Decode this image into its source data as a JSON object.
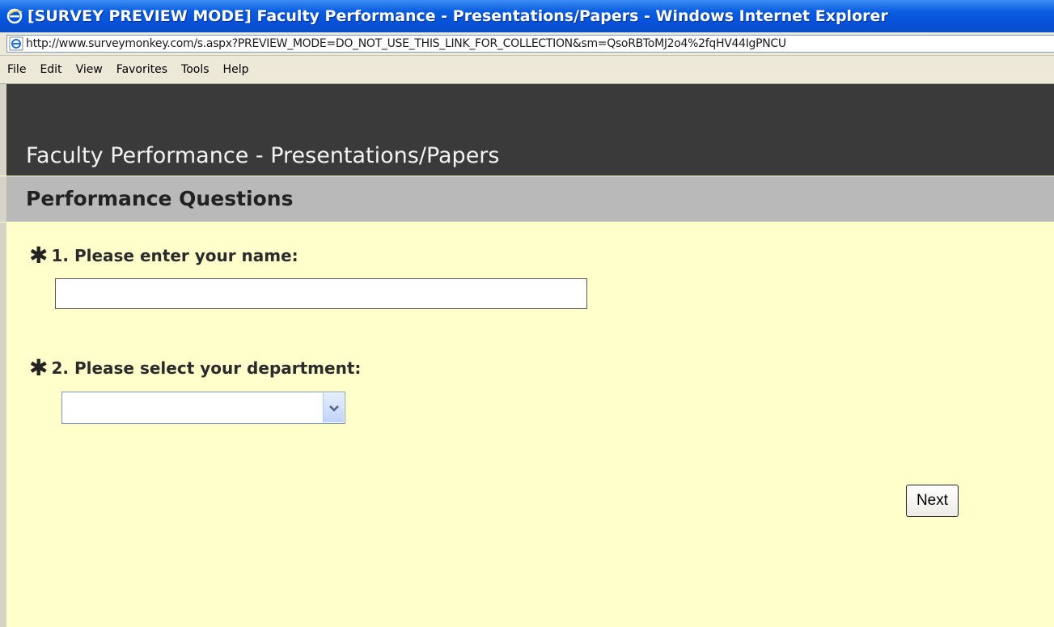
{
  "window": {
    "title": "[SURVEY PREVIEW MODE] Faculty Performance - Presentations/Papers - Windows Internet Explorer",
    "icon": "ie-icon"
  },
  "address_bar": {
    "url": "http://www.surveymonkey.com/s.aspx?PREVIEW_MODE=DO_NOT_USE_THIS_LINK_FOR_COLLECTION&sm=QsoRBToMJ2o4%2fqHV44IgPNCU",
    "icon": "page-icon"
  },
  "menu": {
    "items": [
      "File",
      "Edit",
      "View",
      "Favorites",
      "Tools",
      "Help"
    ]
  },
  "survey": {
    "title": "Faculty Performance - Presentations/Papers",
    "page_title": "Performance Questions",
    "required_mark": "✱",
    "questions": [
      {
        "label": "1. Please enter your name:",
        "value": ""
      },
      {
        "label": "2. Please select your department:",
        "selected": ""
      }
    ],
    "next_label": "Next"
  },
  "colors": {
    "titlebar": "#0651d9",
    "survey_header": "#3a3a3a",
    "page_header": "#b9b9b9",
    "content_background": "#ffffcc"
  }
}
